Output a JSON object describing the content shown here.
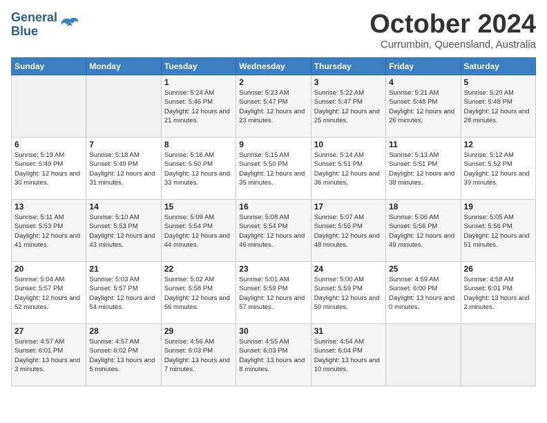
{
  "header": {
    "logo_line1": "General",
    "logo_line2": "Blue",
    "month": "October 2024",
    "location": "Currumbin, Queensland, Australia"
  },
  "days_of_week": [
    "Sunday",
    "Monday",
    "Tuesday",
    "Wednesday",
    "Thursday",
    "Friday",
    "Saturday"
  ],
  "weeks": [
    [
      {
        "day": "",
        "info": ""
      },
      {
        "day": "",
        "info": ""
      },
      {
        "day": "1",
        "info": "Sunrise: 5:24 AM\nSunset: 5:46 PM\nDaylight: 12 hours and 21 minutes."
      },
      {
        "day": "2",
        "info": "Sunrise: 5:23 AM\nSunset: 5:47 PM\nDaylight: 12 hours and 23 minutes."
      },
      {
        "day": "3",
        "info": "Sunrise: 5:22 AM\nSunset: 5:47 PM\nDaylight: 12 hours and 25 minutes."
      },
      {
        "day": "4",
        "info": "Sunrise: 5:21 AM\nSunset: 5:48 PM\nDaylight: 12 hours and 26 minutes."
      },
      {
        "day": "5",
        "info": "Sunrise: 5:20 AM\nSunset: 5:48 PM\nDaylight: 12 hours and 28 minutes."
      }
    ],
    [
      {
        "day": "6",
        "info": "Sunrise: 5:19 AM\nSunset: 5:49 PM\nDaylight: 12 hours and 30 minutes."
      },
      {
        "day": "7",
        "info": "Sunrise: 5:18 AM\nSunset: 5:49 PM\nDaylight: 12 hours and 31 minutes."
      },
      {
        "day": "8",
        "info": "Sunrise: 5:16 AM\nSunset: 5:50 PM\nDaylight: 12 hours and 33 minutes."
      },
      {
        "day": "9",
        "info": "Sunrise: 5:15 AM\nSunset: 5:50 PM\nDaylight: 12 hours and 35 minutes."
      },
      {
        "day": "10",
        "info": "Sunrise: 5:14 AM\nSunset: 5:51 PM\nDaylight: 12 hours and 36 minutes."
      },
      {
        "day": "11",
        "info": "Sunrise: 5:13 AM\nSunset: 5:51 PM\nDaylight: 12 hours and 38 minutes."
      },
      {
        "day": "12",
        "info": "Sunrise: 5:12 AM\nSunset: 5:52 PM\nDaylight: 12 hours and 39 minutes."
      }
    ],
    [
      {
        "day": "13",
        "info": "Sunrise: 5:11 AM\nSunset: 5:53 PM\nDaylight: 12 hours and 41 minutes."
      },
      {
        "day": "14",
        "info": "Sunrise: 5:10 AM\nSunset: 5:53 PM\nDaylight: 12 hours and 43 minutes."
      },
      {
        "day": "15",
        "info": "Sunrise: 5:09 AM\nSunset: 5:54 PM\nDaylight: 12 hours and 44 minutes."
      },
      {
        "day": "16",
        "info": "Sunrise: 5:08 AM\nSunset: 5:54 PM\nDaylight: 12 hours and 46 minutes."
      },
      {
        "day": "17",
        "info": "Sunrise: 5:07 AM\nSunset: 5:55 PM\nDaylight: 12 hours and 48 minutes."
      },
      {
        "day": "18",
        "info": "Sunrise: 5:06 AM\nSunset: 5:56 PM\nDaylight: 12 hours and 49 minutes."
      },
      {
        "day": "19",
        "info": "Sunrise: 5:05 AM\nSunset: 5:56 PM\nDaylight: 12 hours and 51 minutes."
      }
    ],
    [
      {
        "day": "20",
        "info": "Sunrise: 5:04 AM\nSunset: 5:57 PM\nDaylight: 12 hours and 52 minutes."
      },
      {
        "day": "21",
        "info": "Sunrise: 5:03 AM\nSunset: 5:57 PM\nDaylight: 12 hours and 54 minutes."
      },
      {
        "day": "22",
        "info": "Sunrise: 5:02 AM\nSunset: 5:58 PM\nDaylight: 12 hours and 56 minutes."
      },
      {
        "day": "23",
        "info": "Sunrise: 5:01 AM\nSunset: 5:59 PM\nDaylight: 12 hours and 57 minutes."
      },
      {
        "day": "24",
        "info": "Sunrise: 5:00 AM\nSunset: 5:59 PM\nDaylight: 12 hours and 59 minutes."
      },
      {
        "day": "25",
        "info": "Sunrise: 4:59 AM\nSunset: 6:00 PM\nDaylight: 13 hours and 0 minutes."
      },
      {
        "day": "26",
        "info": "Sunrise: 4:58 AM\nSunset: 6:01 PM\nDaylight: 13 hours and 2 minutes."
      }
    ],
    [
      {
        "day": "27",
        "info": "Sunrise: 4:57 AM\nSunset: 6:01 PM\nDaylight: 13 hours and 3 minutes."
      },
      {
        "day": "28",
        "info": "Sunrise: 4:57 AM\nSunset: 6:02 PM\nDaylight: 13 hours and 5 minutes."
      },
      {
        "day": "29",
        "info": "Sunrise: 4:56 AM\nSunset: 6:03 PM\nDaylight: 13 hours and 7 minutes."
      },
      {
        "day": "30",
        "info": "Sunrise: 4:55 AM\nSunset: 6:03 PM\nDaylight: 13 hours and 8 minutes."
      },
      {
        "day": "31",
        "info": "Sunrise: 4:54 AM\nSunset: 6:04 PM\nDaylight: 13 hours and 10 minutes."
      },
      {
        "day": "",
        "info": ""
      },
      {
        "day": "",
        "info": ""
      }
    ]
  ]
}
